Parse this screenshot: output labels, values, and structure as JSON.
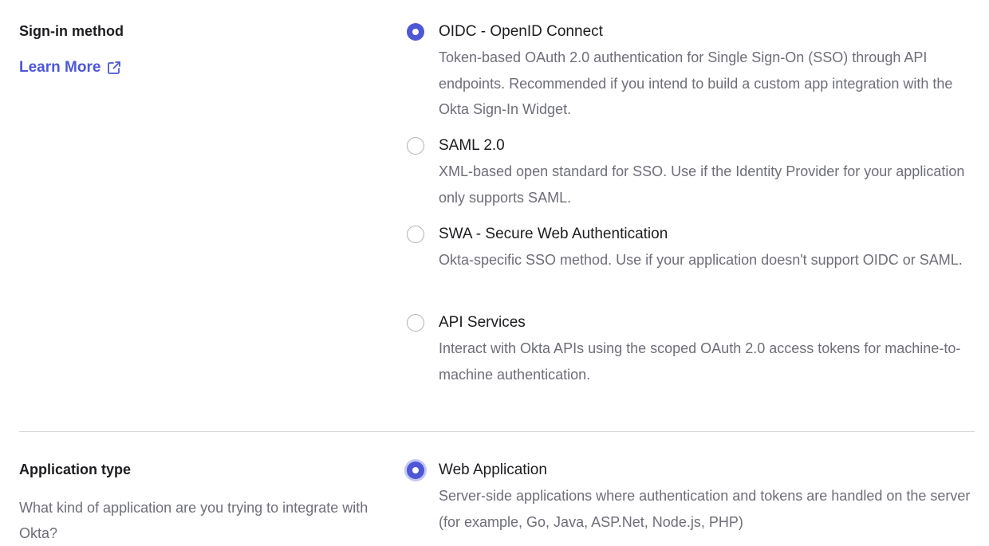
{
  "signin": {
    "title": "Sign-in method",
    "learn_more": "Learn More",
    "learn_more_icon": "external-link-icon",
    "options": [
      {
        "label": "OIDC - OpenID Connect",
        "description": "Token-based OAuth 2.0 authentication for Single Sign-On (SSO) through API endpoints. Recommended if you intend to build a custom app integration with the Okta Sign-In Widget.",
        "selected": true
      },
      {
        "label": "SAML 2.0",
        "description": "XML-based open standard for SSO. Use if the Identity Provider for your application only supports SAML.",
        "selected": false
      },
      {
        "label": "SWA - Secure Web Authentication",
        "description": "Okta-specific SSO method. Use if your application doesn't support OIDC or SAML.",
        "selected": false
      },
      {
        "label": "API Services",
        "description": "Interact with Okta APIs using the scoped OAuth 2.0 access tokens for machine-to-machine authentication.",
        "selected": false
      }
    ]
  },
  "app_type": {
    "title": "Application type",
    "description": "What kind of application are you trying to integrate with Okta?",
    "options": [
      {
        "label": "Web Application",
        "description": "Server-side applications where authentication and tokens are handled on the server (for example, Go, Java, ASP.Net, Node.js, PHP)",
        "selected": true
      }
    ]
  },
  "colors": {
    "accent": "#4e57d6",
    "text_primary": "#1d1d21",
    "text_secondary": "#6e6e78",
    "divider": "#d7d7dc"
  }
}
